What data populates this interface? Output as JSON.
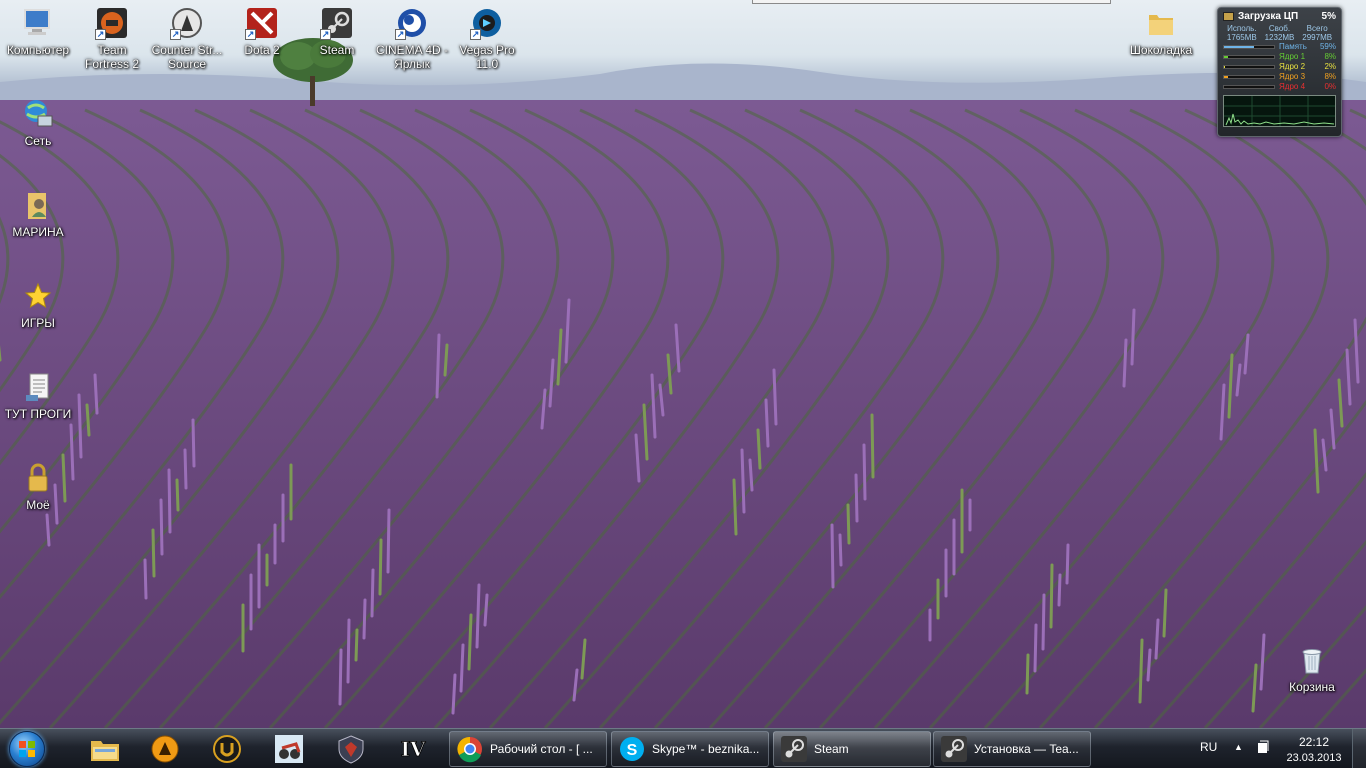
{
  "desktop_icons": [
    {
      "label": "Компьютер",
      "icon": "computer-icon"
    },
    {
      "label": "Team Fortress 2",
      "icon": "team-fortress-icon"
    },
    {
      "label": "Counter Str... Source",
      "icon": "counter-strike-icon"
    },
    {
      "label": "Dota 2",
      "icon": "dota2-icon"
    },
    {
      "label": "Steam",
      "icon": "steam-icon"
    },
    {
      "label": "CINEMA 4D - Ярлык",
      "icon": "cinema4d-icon"
    },
    {
      "label": "Vegas Pro 11.0",
      "icon": "vegas-pro-icon"
    },
    {
      "label": "Шоколадка",
      "icon": "folder-icon"
    },
    {
      "label": "Сеть",
      "icon": "network-icon"
    },
    {
      "label": "МАРИНА",
      "icon": "user-folder-icon"
    },
    {
      "label": "ИГРЫ",
      "icon": "star-icon"
    },
    {
      "label": "ТУТ ПРОГИ",
      "icon": "document-icon"
    },
    {
      "label": "Моё",
      "icon": "lock-icon"
    },
    {
      "label": "Корзина",
      "icon": "recycle-bin-icon"
    }
  ],
  "gadget": {
    "title": "Загрузка ЦП",
    "total_cpu": "5%",
    "headers": [
      "Исполь.",
      "Своб.",
      "Всего"
    ],
    "values": [
      "1765MB",
      "1232MB",
      "2997MB"
    ],
    "rows": [
      {
        "name": "Память",
        "value": "59%",
        "fill": 0.59,
        "color": "#6fb4e8"
      },
      {
        "name": "Ядро 1",
        "value": "8%",
        "fill": 0.08,
        "color": "#66cc33"
      },
      {
        "name": "Ядро 2",
        "value": "2%",
        "fill": 0.02,
        "color": "#e8e040"
      },
      {
        "name": "Ядро 3",
        "value": "8%",
        "fill": 0.08,
        "color": "#f0a020"
      },
      {
        "name": "Ядро 4",
        "value": "0%",
        "fill": 0.0,
        "color": "#e83030"
      }
    ]
  },
  "taskbar": {
    "pinned": [
      "explorer-icon",
      "aimp-icon",
      "unreal-icon",
      "game-icon",
      "shield-game-icon",
      "gta-iv-icon"
    ],
    "pinned_text": {
      "gta": "IV"
    },
    "tasks": [
      {
        "label": "Рабочий стол - [ ...",
        "icon": "chrome-icon"
      },
      {
        "label": "Skype™ - beznika...",
        "icon": "skype-icon"
      },
      {
        "label": "Steam",
        "icon": "steam-icon"
      },
      {
        "label": "Установка — Tea...",
        "icon": "steam-icon"
      }
    ],
    "language": "RU",
    "time": "22:12",
    "date": "23.03.2013"
  }
}
